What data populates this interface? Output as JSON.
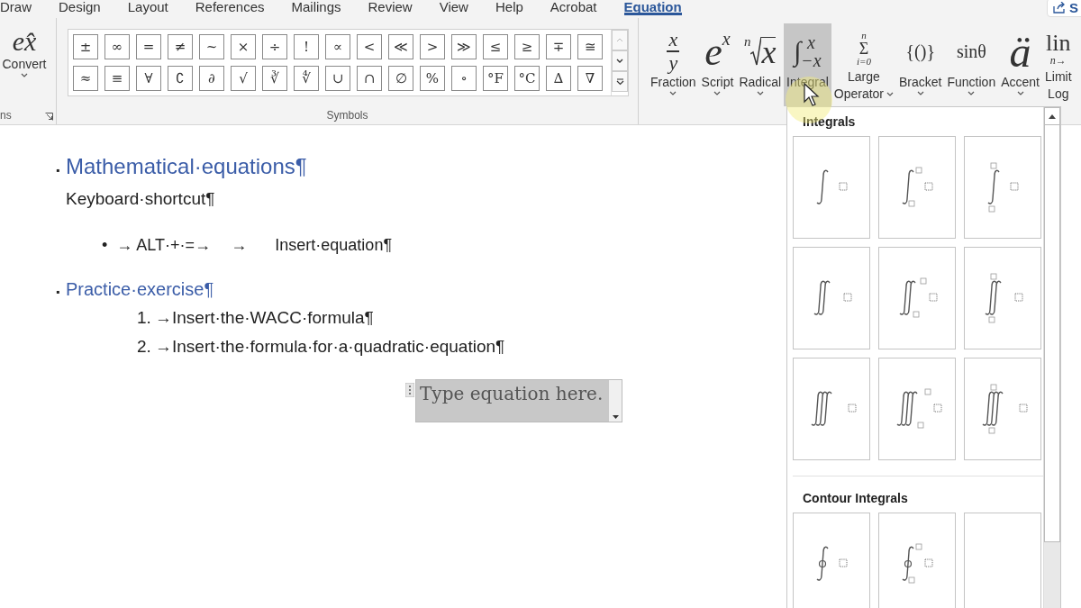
{
  "tabs": [
    {
      "label": "Draw",
      "selected": false
    },
    {
      "label": "Design",
      "selected": false
    },
    {
      "label": "Layout",
      "selected": false
    },
    {
      "label": "References",
      "selected": false
    },
    {
      "label": "Mailings",
      "selected": false
    },
    {
      "label": "Review",
      "selected": false
    },
    {
      "label": "View",
      "selected": false
    },
    {
      "label": "Help",
      "selected": false
    },
    {
      "label": "Acrobat",
      "selected": false
    },
    {
      "label": "Equation",
      "selected": true
    }
  ],
  "share_button": {
    "label": "S"
  },
  "conversions": {
    "glyph": "ex̂",
    "label": "Convert",
    "group_label": "ns"
  },
  "symbols": {
    "group_label": "Symbols",
    "rows": [
      [
        "±",
        "∞",
        "=",
        "≠",
        "~",
        "×",
        "÷",
        "!",
        "∝",
        "<",
        "≪",
        ">",
        "≫",
        "≤",
        "≥",
        "∓",
        "≅"
      ],
      [
        "≈",
        "≡",
        "∀",
        "∁",
        "∂",
        "√",
        "∛",
        "∜",
        "∪",
        "∩",
        "∅",
        "%",
        "∘",
        "°F",
        "°C",
        "∆",
        "∇"
      ]
    ]
  },
  "structures": [
    {
      "kind": "fraction",
      "parts": [
        "x",
        "y"
      ],
      "label": [
        "Fraction"
      ],
      "has_menu": true,
      "selected": false
    },
    {
      "kind": "script",
      "parts": [
        "e",
        "x"
      ],
      "label": [
        "Script"
      ],
      "has_menu": true,
      "selected": false
    },
    {
      "kind": "radical",
      "parts": [
        "n",
        "x"
      ],
      "label": [
        "Radical"
      ],
      "has_menu": true,
      "selected": false
    },
    {
      "kind": "integral",
      "parts": [
        "∫",
        "x",
        "−x"
      ],
      "label": [
        "Integral"
      ],
      "has_menu": false,
      "selected": true
    },
    {
      "kind": "stack",
      "parts": [
        "n",
        "Σ",
        "i=0"
      ],
      "label": [
        "Large",
        "Operator"
      ],
      "has_menu": true,
      "selected": false
    },
    {
      "kind": "text",
      "parts": [
        "{()}"
      ],
      "label": [
        "Bracket"
      ],
      "has_menu": true,
      "selected": false
    },
    {
      "kind": "text",
      "parts": [
        "sinθ"
      ],
      "label": [
        "Function"
      ],
      "has_menu": true,
      "selected": false
    },
    {
      "kind": "big",
      "parts": [
        "ä"
      ],
      "label": [
        "Accent"
      ],
      "has_menu": true,
      "selected": false
    },
    {
      "kind": "limit",
      "parts": [
        "lin",
        "n→"
      ],
      "label": [
        "Limit",
        "Log"
      ],
      "has_menu": false,
      "selected": false
    }
  ],
  "document": {
    "blocks": [
      {
        "kind": "heading",
        "marker": "▪",
        "text": "Mathematical·equations¶"
      },
      {
        "kind": "body",
        "text": "Keyboard·shortcut¶"
      },
      {
        "kind": "bullet",
        "marker": "•",
        "parts": [
          "→ ALT·+·=→",
          "→",
          "Insert·equation¶"
        ]
      },
      {
        "kind": "heading2",
        "marker": "▪",
        "text": "Practice·exercise¶"
      },
      {
        "kind": "numbered",
        "marker": "1.",
        "text": "→Insert·the·WACC·formula¶"
      },
      {
        "kind": "numbered",
        "marker": "2.",
        "text": "→Insert·the·formula·for·a·quadratic·equation¶"
      },
      {
        "kind": "equation",
        "text": "Type equation here."
      }
    ]
  },
  "gallery": {
    "sections": [
      {
        "title": "Integrals",
        "tiles": [
          {
            "kind": "single"
          },
          {
            "kind": "single_side"
          },
          {
            "kind": "single_stacked"
          },
          {
            "kind": "double"
          },
          {
            "kind": "double_side"
          },
          {
            "kind": "double_stacked"
          },
          {
            "kind": "triple"
          },
          {
            "kind": "triple_side"
          },
          {
            "kind": "triple_stacked"
          }
        ]
      },
      {
        "title": "Contour Integrals",
        "tiles": [
          {
            "kind": "contour"
          },
          {
            "kind": "contour_side"
          },
          {
            "kind": "blank"
          }
        ]
      }
    ]
  }
}
